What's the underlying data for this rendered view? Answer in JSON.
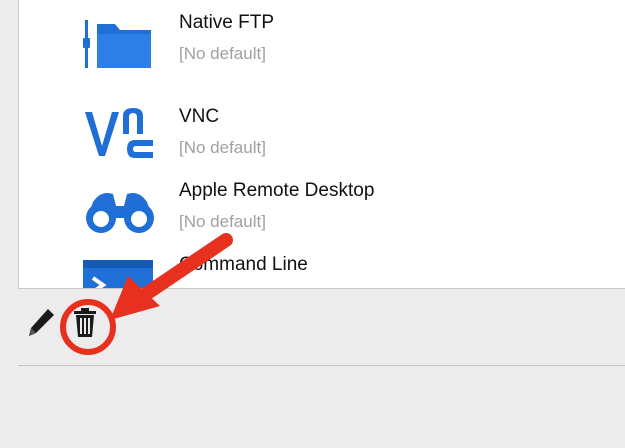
{
  "connection_types": [
    {
      "name": "Native FTP",
      "default": "[No default]",
      "icon": "folder-icon"
    },
    {
      "name": "VNC",
      "default": "[No default]",
      "icon": "vnc-logo-icon"
    },
    {
      "name": "Apple Remote Desktop",
      "default": "[No default]",
      "icon": "binoculars-icon"
    },
    {
      "name": "Command Line",
      "icon": "terminal-icon"
    }
  ],
  "toolbar": {
    "edit_icon": "pencil-icon",
    "delete_icon": "trash-icon"
  },
  "annotation": {
    "color": "#e8301e",
    "highlight_target": "delete-button"
  },
  "colors": {
    "icon_blue": "#1f6fd6",
    "secondary_text": "#a0a0a0"
  }
}
